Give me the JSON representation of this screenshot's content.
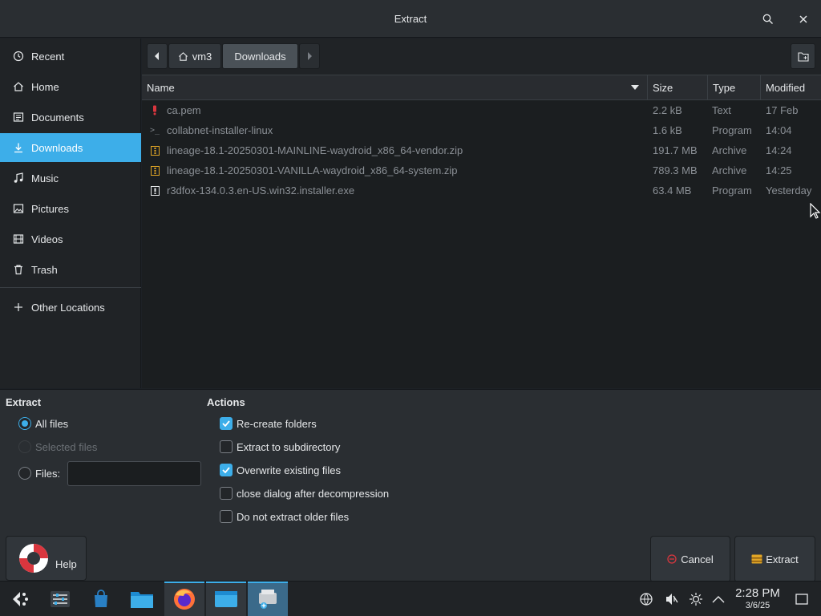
{
  "window": {
    "title": "Extract"
  },
  "sidebar": {
    "items": [
      {
        "label": "Recent",
        "icon": "clock-icon"
      },
      {
        "label": "Home",
        "icon": "home-icon"
      },
      {
        "label": "Documents",
        "icon": "document-icon"
      },
      {
        "label": "Downloads",
        "icon": "download-icon",
        "active": true
      },
      {
        "label": "Music",
        "icon": "music-icon"
      },
      {
        "label": "Pictures",
        "icon": "picture-icon"
      },
      {
        "label": "Videos",
        "icon": "video-icon"
      },
      {
        "label": "Trash",
        "icon": "trash-icon"
      }
    ],
    "other_locations": "Other Locations"
  },
  "pathbar": {
    "crumbs": [
      "vm3",
      "Downloads"
    ]
  },
  "filelist": {
    "columns": {
      "name": "Name",
      "size": "Size",
      "type": "Type",
      "modified": "Modified"
    },
    "rows": [
      {
        "name": "ca.pem",
        "size": "2.2 kB",
        "type": "Text",
        "modified": "17 Feb",
        "icon": "certificate-icon"
      },
      {
        "name": "collabnet-installer-linux",
        "size": "1.6 kB",
        "type": "Program",
        "modified": "14:04",
        "icon": "terminal-icon"
      },
      {
        "name": "lineage-18.1-20250301-MAINLINE-waydroid_x86_64-vendor.zip",
        "size": "191.7 MB",
        "type": "Archive",
        "modified": "14:24",
        "icon": "archive-icon"
      },
      {
        "name": "lineage-18.1-20250301-VANILLA-waydroid_x86_64-system.zip",
        "size": "789.3 MB",
        "type": "Archive",
        "modified": "14:25",
        "icon": "archive-icon"
      },
      {
        "name": "r3dfox-134.0.3.en-US.win32.installer.exe",
        "size": "63.4 MB",
        "type": "Program",
        "modified": "Yesterday",
        "icon": "executable-icon"
      }
    ]
  },
  "extract": {
    "title": "Extract",
    "all_files": "All files",
    "selected_files": "Selected files",
    "files": "Files:",
    "files_value": ""
  },
  "actions": {
    "title": "Actions",
    "recreate_folders": {
      "label": "Re-create folders",
      "checked": true
    },
    "extract_to_subdir": {
      "label": "Extract to subdirectory",
      "checked": false
    },
    "overwrite": {
      "label": "Overwrite existing files",
      "checked": true
    },
    "close_dialog": {
      "label": "close dialog after decompression",
      "checked": false
    },
    "do_not_extract_older": {
      "label": "Do not extract older files",
      "checked": false
    }
  },
  "buttons": {
    "help": "Help",
    "cancel": "Cancel",
    "extract": "Extract"
  },
  "taskbar": {
    "time": "2:28 PM",
    "date": "3/6/25"
  },
  "colors": {
    "accent": "#3daee9",
    "background": "#1b1e20",
    "panel": "#2a2e32"
  }
}
